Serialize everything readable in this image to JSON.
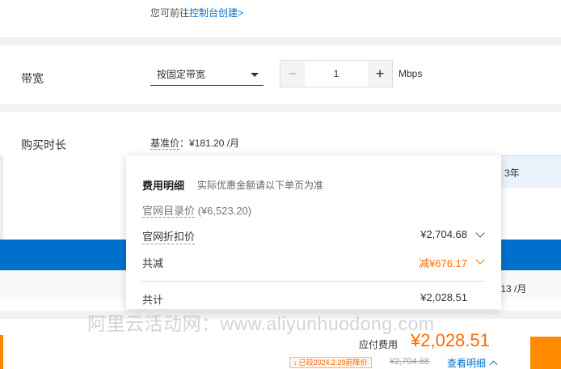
{
  "top_hint": {
    "prefix": "您可前往",
    "link": "控制台创建>"
  },
  "bandwidth": {
    "label": "带宽",
    "select_value": "按固定带宽",
    "stepper_value": "1",
    "minus": "−",
    "plus": "+",
    "unit": "Mbps"
  },
  "duration": {
    "label": "购买时长",
    "base_label": "基准价",
    "base_value": "：¥181.20 /月",
    "option_3y": "3年",
    "option_price_suffix": ".13 /月"
  },
  "popup": {
    "title": "费用明细",
    "subtitle": "实际优惠金额请以下单页为准",
    "list_price_label": "官网目录价",
    "list_price_value": " (¥6,523.20)",
    "discount_label": "官网折扣价",
    "discount_value": "¥2,704.68",
    "reduce_label": "共减",
    "reduce_value": "减¥676.17",
    "total_label": "共计",
    "total_value": "¥2,028.51"
  },
  "watermark": "阿里云活动网：www.aliyunhuodong.com",
  "footer": {
    "pay_label": "应付费用",
    "pay_amount": "¥2,028.51",
    "badge_arrow": "↓",
    "badge_text": "已较2024.2.29前降价",
    "strike_price": "¥2,704.68",
    "detail_link": "查看明细"
  },
  "colors": {
    "accent_blue": "#0070cc",
    "accent_orange": "#ff6a00"
  }
}
